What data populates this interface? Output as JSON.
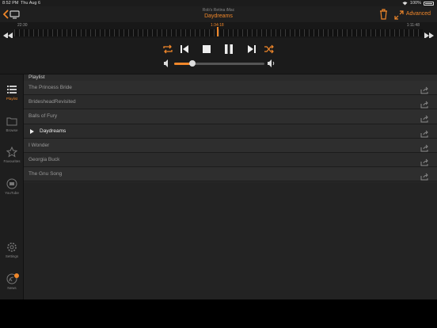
{
  "status": {
    "time": "8:52 PM",
    "date": "Thu Aug 6",
    "battery": "100%"
  },
  "header": {
    "device": "Rob's Retina iMac",
    "title": "Daydreams",
    "advanced_label": "Advanced"
  },
  "timeline": {
    "elapsed": "22:30",
    "current": "1:34:18",
    "total": "1:11:48"
  },
  "volume": {
    "level": 0.2
  },
  "sidebar": {
    "items": [
      {
        "label": "Playlist",
        "icon": "list-icon",
        "active": true
      },
      {
        "label": "Browse",
        "icon": "folder-icon"
      },
      {
        "label": "Favourites",
        "icon": "star-icon"
      },
      {
        "label": "YouTube",
        "icon": "youtube-icon"
      },
      {
        "label": "Settings",
        "icon": "gear-icon"
      },
      {
        "label": "News",
        "icon": "news-icon"
      }
    ]
  },
  "playlist": {
    "header": "Playlist",
    "tracks": [
      {
        "name": "The Princess Bride"
      },
      {
        "name": "BridesheadRevisited"
      },
      {
        "name": "Balls of Fury"
      },
      {
        "name": "Daydreams",
        "playing": true
      },
      {
        "name": "I Wonder"
      },
      {
        "name": "Georgia Buck"
      },
      {
        "name": "The Gnu Song"
      }
    ]
  },
  "colors": {
    "accent": "#f0872a",
    "background": "#2a2a2a"
  }
}
